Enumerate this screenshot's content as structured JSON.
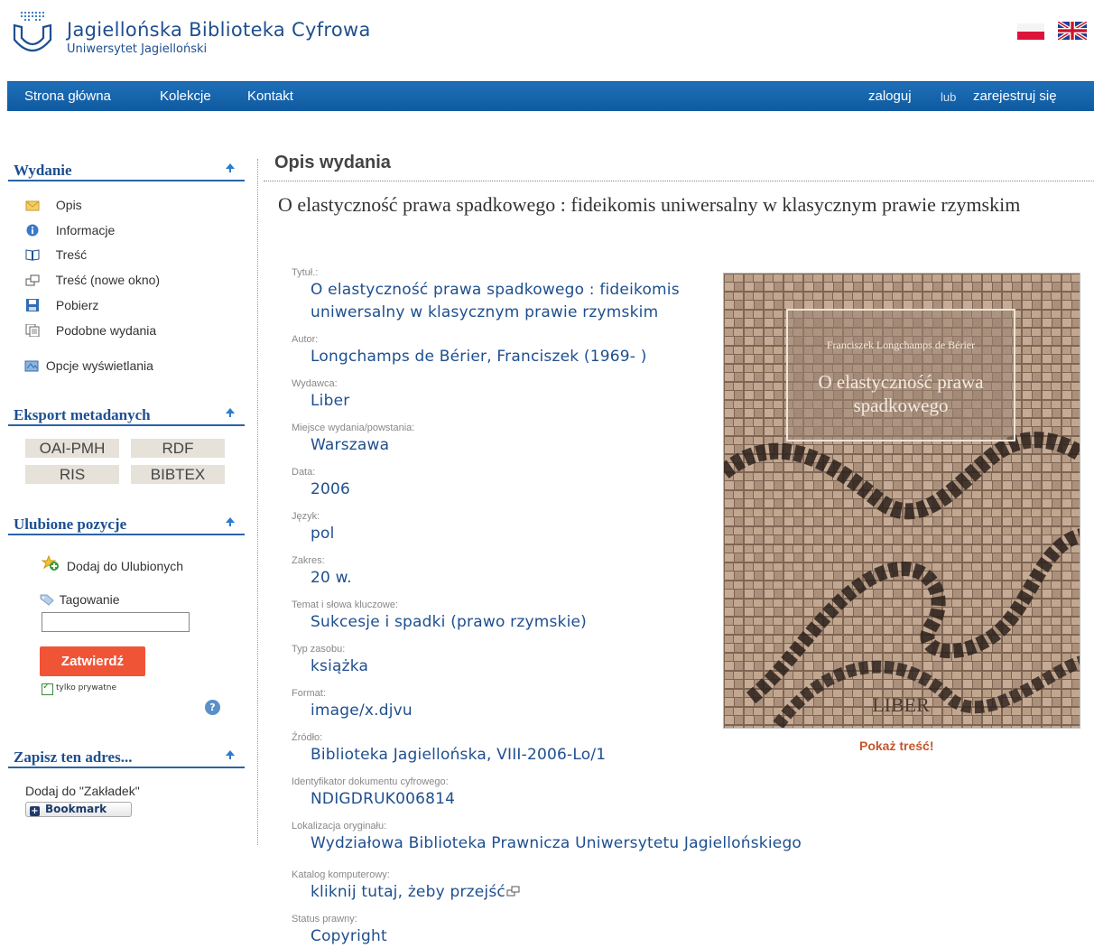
{
  "header": {
    "title": "Jagiellońska Biblioteka Cyfrowa",
    "subtitle": "Uniwersytet Jagielloński"
  },
  "nav": {
    "home": "Strona główna",
    "collections": "Kolekcje",
    "contact": "Kontakt",
    "login": "zaloguj",
    "or": "lub",
    "register": "zarejestruj się"
  },
  "sidebar": {
    "edition": {
      "title": "Wydanie",
      "items": [
        {
          "label": "Opis",
          "icon": "envelope-icon"
        },
        {
          "label": "Informacje",
          "icon": "info-icon"
        },
        {
          "label": "Treść",
          "icon": "book-icon"
        },
        {
          "label": "Treść (nowe okno)",
          "icon": "new-window-icon"
        },
        {
          "label": "Pobierz",
          "icon": "save-icon"
        },
        {
          "label": "Podobne wydania",
          "icon": "documents-icon"
        }
      ],
      "display_options": "Opcje wyświetlania"
    },
    "export": {
      "title": "Eksport metadanych",
      "buttons": [
        "OAI-PMH",
        "RDF",
        "RIS",
        "BIBTEX"
      ]
    },
    "favorites": {
      "title": "Ulubione pozycje",
      "add": "Dodaj do Ulubionych",
      "tagging": "Tagowanie",
      "tag_value": "",
      "submit": "Zatwierdź",
      "private_only": "tylko prywatne",
      "help": "?"
    },
    "save_address": {
      "title": "Zapisz ten adres...",
      "bookmarks_text": "Dodaj do \"Zakładek\"",
      "bookmark_button": "Bookmark"
    }
  },
  "main": {
    "heading": "Opis wydania",
    "title": "O elastyczność prawa spadkowego : fideikomis uniwersalny w klasycznym prawie rzymskim",
    "fields": [
      {
        "label": "Tytuł.:",
        "value": "O elastyczność prawa spadkowego : fideikomis"
      },
      {
        "label": "",
        "value": "uniwersalny w klasycznym prawie rzymskim"
      },
      {
        "label": "Autor:",
        "value": "Longchamps de Bérier, Franciszek (1969- )"
      },
      {
        "label": "Wydawca:",
        "value": "Liber"
      },
      {
        "label": "Miejsce wydania/powstania:",
        "value": "Warszawa"
      },
      {
        "label": "Data:",
        "value": "2006"
      },
      {
        "label": "Język:",
        "value": "pol"
      },
      {
        "label": "Zakres:",
        "value": "20 w."
      },
      {
        "label": "Temat i słowa kluczowe:",
        "value": "Sukcesje i spadki (prawo rzymskie)"
      },
      {
        "label": "Typ zasobu:",
        "value": "książka"
      },
      {
        "label": "Format:",
        "value": "image/x.djvu"
      },
      {
        "label": "Źródło:",
        "value": "Biblioteka Jagiellońska, VIII-2006-Lo/1"
      },
      {
        "label": "Identyfikator dokumentu cyfrowego:",
        "value": "NDIGDRUK006814"
      },
      {
        "label": "Lokalizacja oryginału:",
        "value": "Wydziałowa Biblioteka Prawnicza Uniwersytetu Jagiellońskiego"
      },
      {
        "label": "Katalog komputerowy:",
        "value": "kliknij tutaj, żeby przejść"
      },
      {
        "label": "Status prawny:",
        "value": "Copyright"
      }
    ],
    "cover": {
      "author": "Franciszek Longchamps de Bérier",
      "title_line1": "O elastyczność prawa",
      "title_line2": "spadkowego",
      "publisher": "LIBER"
    },
    "show_content": "Pokaż treść!"
  },
  "colors": {
    "nav_blue": "#1565b0",
    "link_blue": "#1e4f8f",
    "submit_red": "#f05437",
    "show_content": "#c4572d"
  }
}
